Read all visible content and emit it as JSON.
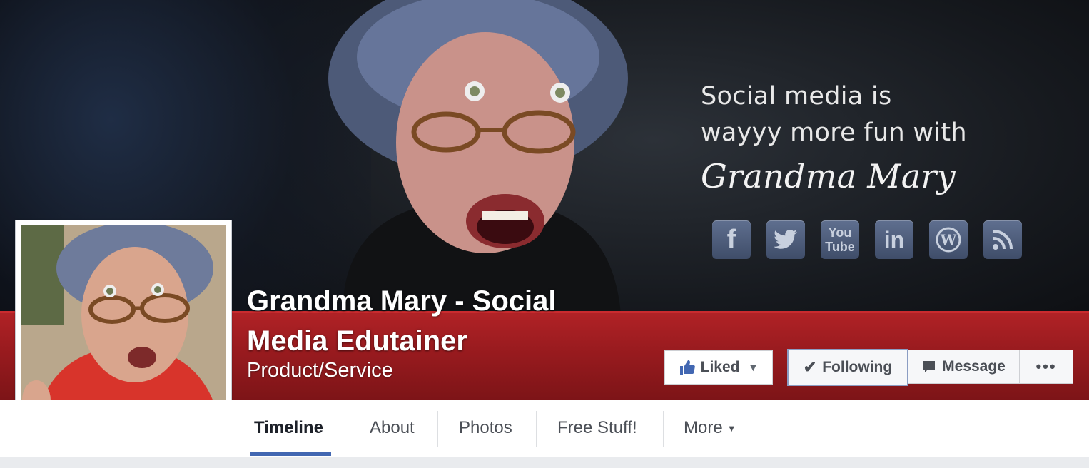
{
  "cover": {
    "tagline_line1": "Social media is",
    "tagline_line2": "wayyy more fun with",
    "tagline_script": "Grandma Mary",
    "social_icons": [
      "facebook-icon",
      "twitter-icon",
      "youtube-icon",
      "linkedin-icon",
      "wordpress-icon",
      "rss-icon"
    ],
    "youtube_label_top": "You",
    "youtube_label_bottom": "Tube",
    "linkedin_label": "in",
    "facebook_label": "f"
  },
  "page": {
    "name": "Grandma Mary - Social Media Edutainer",
    "category": "Product/Service"
  },
  "actions": {
    "liked_label": "Liked",
    "following_label": "Following",
    "message_label": "Message",
    "more_label": "•••"
  },
  "tabs": [
    {
      "label": "Timeline"
    },
    {
      "label": "About"
    },
    {
      "label": "Photos"
    },
    {
      "label": "Free Stuff!"
    },
    {
      "label": "More"
    }
  ],
  "colors": {
    "band_red": "#9a1b1f",
    "accent_blue": "#4267b2"
  }
}
